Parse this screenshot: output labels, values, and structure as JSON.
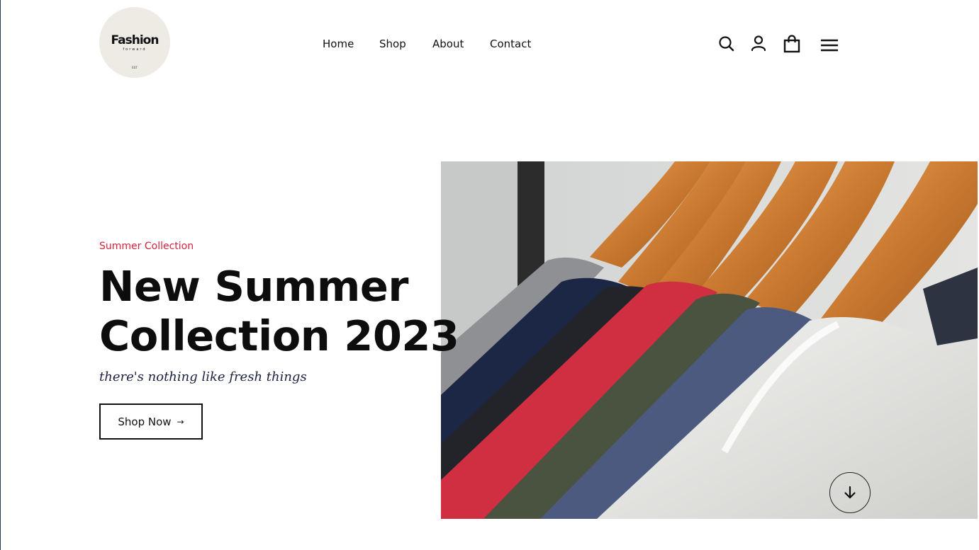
{
  "header": {
    "logo": {
      "wordmark": "Fashion",
      "subtitle": "forward",
      "year": "EST"
    },
    "nav": [
      {
        "label": "Home"
      },
      {
        "label": "Shop"
      },
      {
        "label": "About"
      },
      {
        "label": "Contact"
      }
    ],
    "icons": [
      "search-icon",
      "user-icon",
      "shopping-bag-icon",
      "menu-icon"
    ]
  },
  "hero": {
    "eyebrow": "Summer Collection",
    "headline_line1": "New Summer",
    "headline_line2": "Collection 2023",
    "tagline": "there's nothing like fresh things",
    "cta_label": "Shop Now",
    "cta_arrow": "→",
    "image_subject": "t-shirts on wooden hangers",
    "scroll_icon": "arrow-down-icon"
  },
  "colors": {
    "accent": "#d9213c",
    "text": "#0d0d0d",
    "tagline": "#1c2140",
    "logo_bg": "#eeebe4"
  }
}
